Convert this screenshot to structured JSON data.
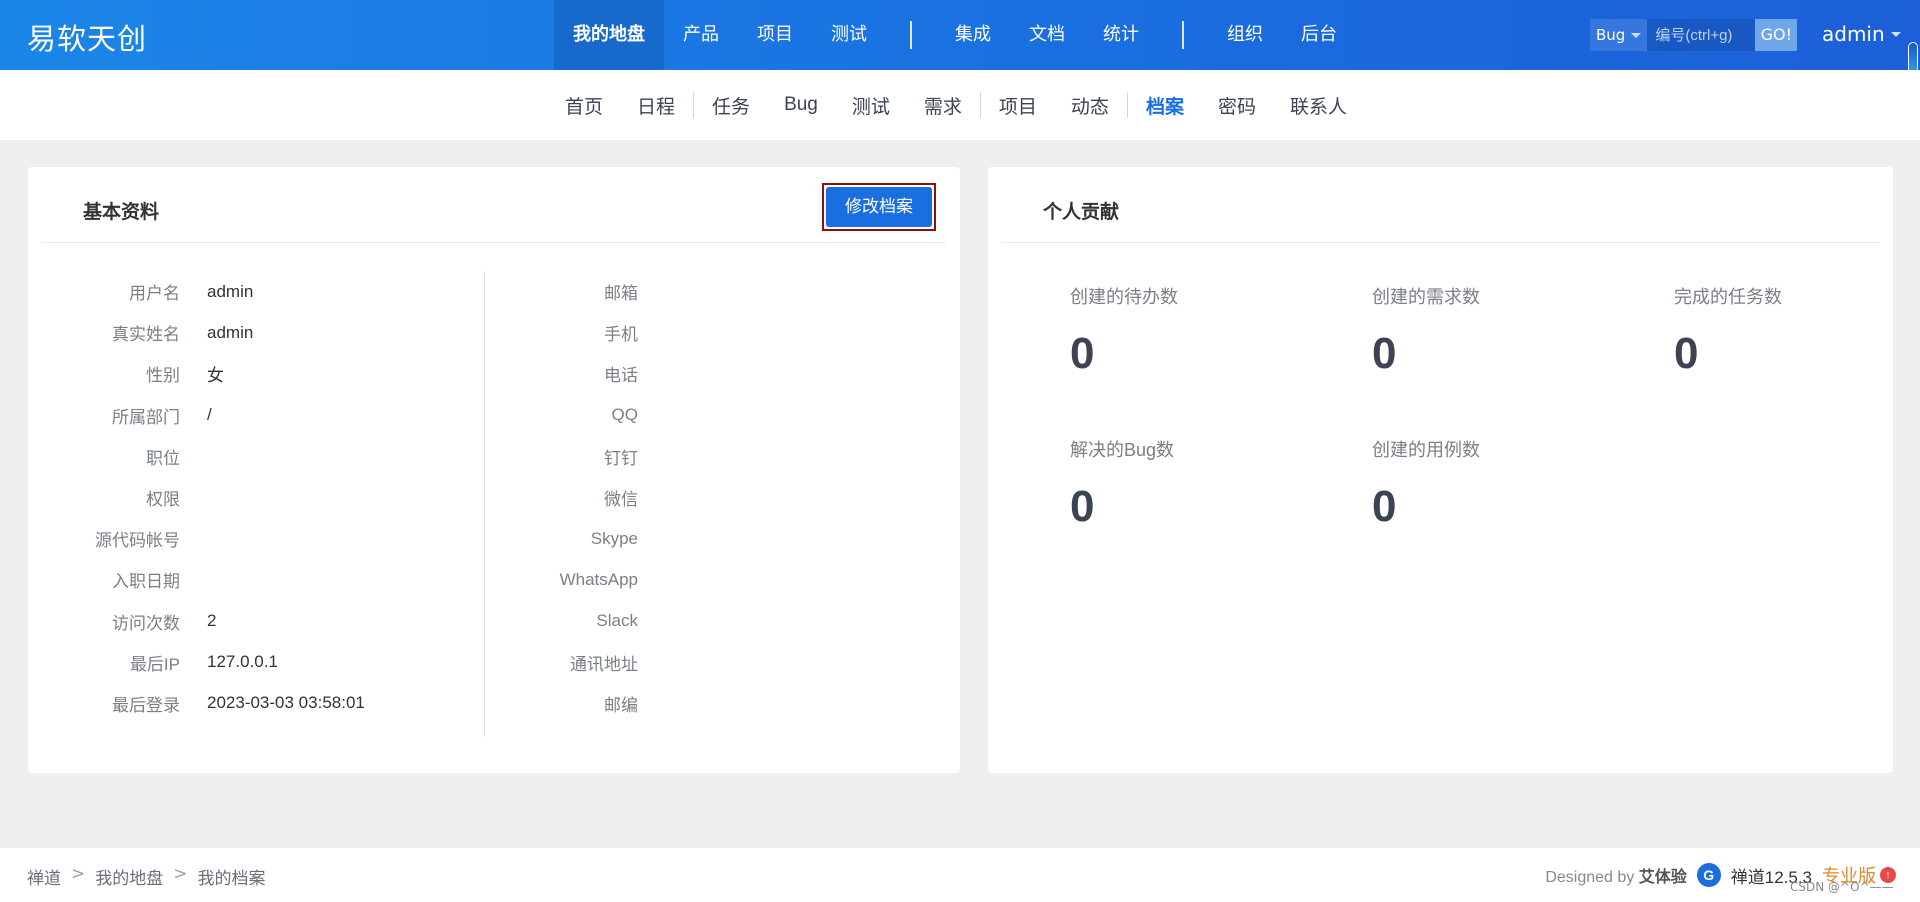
{
  "brand": "易软天创",
  "main_nav": [
    {
      "label": "我的地盘",
      "active": true
    },
    {
      "label": "产品"
    },
    {
      "label": "项目"
    },
    {
      "label": "测试"
    },
    {
      "label": "集成"
    },
    {
      "label": "文档"
    },
    {
      "label": "统计"
    },
    {
      "label": "组织"
    },
    {
      "label": "后台"
    }
  ],
  "search": {
    "type": "Bug",
    "placeholder": "编号(ctrl+g)",
    "go": "GO!"
  },
  "user": "admin",
  "sub_nav": [
    {
      "label": "首页"
    },
    {
      "label": "日程"
    },
    {
      "label": "任务"
    },
    {
      "label": "Bug"
    },
    {
      "label": "测试"
    },
    {
      "label": "需求"
    },
    {
      "label": "项目"
    },
    {
      "label": "动态"
    },
    {
      "label": "档案",
      "active": true
    },
    {
      "label": "密码"
    },
    {
      "label": "联系人"
    }
  ],
  "profile": {
    "title": "基本资料",
    "edit_button": "修改档案",
    "left_fields": [
      {
        "label": "用户名",
        "value": "admin"
      },
      {
        "label": "真实姓名",
        "value": "admin"
      },
      {
        "label": "性别",
        "value": "女"
      },
      {
        "label": "所属部门",
        "value": "/"
      },
      {
        "label": "职位",
        "value": ""
      },
      {
        "label": "权限",
        "value": ""
      },
      {
        "label": "源代码帐号",
        "value": ""
      },
      {
        "label": "入职日期",
        "value": ""
      },
      {
        "label": "访问次数",
        "value": "2"
      },
      {
        "label": "最后IP",
        "value": "127.0.0.1"
      },
      {
        "label": "最后登录",
        "value": "2023-03-03 03:58:01"
      }
    ],
    "right_fields": [
      {
        "label": "邮箱",
        "value": ""
      },
      {
        "label": "手机",
        "value": ""
      },
      {
        "label": "电话",
        "value": ""
      },
      {
        "label": "QQ",
        "value": ""
      },
      {
        "label": "钉钉",
        "value": ""
      },
      {
        "label": "微信",
        "value": ""
      },
      {
        "label": "Skype",
        "value": ""
      },
      {
        "label": "WhatsApp",
        "value": ""
      },
      {
        "label": "Slack",
        "value": ""
      },
      {
        "label": "通讯地址",
        "value": ""
      },
      {
        "label": "邮编",
        "value": ""
      }
    ]
  },
  "contribution": {
    "title": "个人贡献",
    "stats": [
      {
        "label": "创建的待办数",
        "value": "0"
      },
      {
        "label": "创建的需求数",
        "value": "0"
      },
      {
        "label": "完成的任务数",
        "value": "0"
      },
      {
        "label": "解决的Bug数",
        "value": "0"
      },
      {
        "label": "创建的用例数",
        "value": "0"
      }
    ]
  },
  "footer": {
    "breadcrumb": [
      "禅道",
      "我的地盘",
      "我的档案"
    ],
    "designed_by_prefix": "Designed by",
    "designer": "艾体验",
    "version": "禅道12.5.3",
    "edition": "专业版",
    "watermark": "CSDN @^O^——"
  }
}
